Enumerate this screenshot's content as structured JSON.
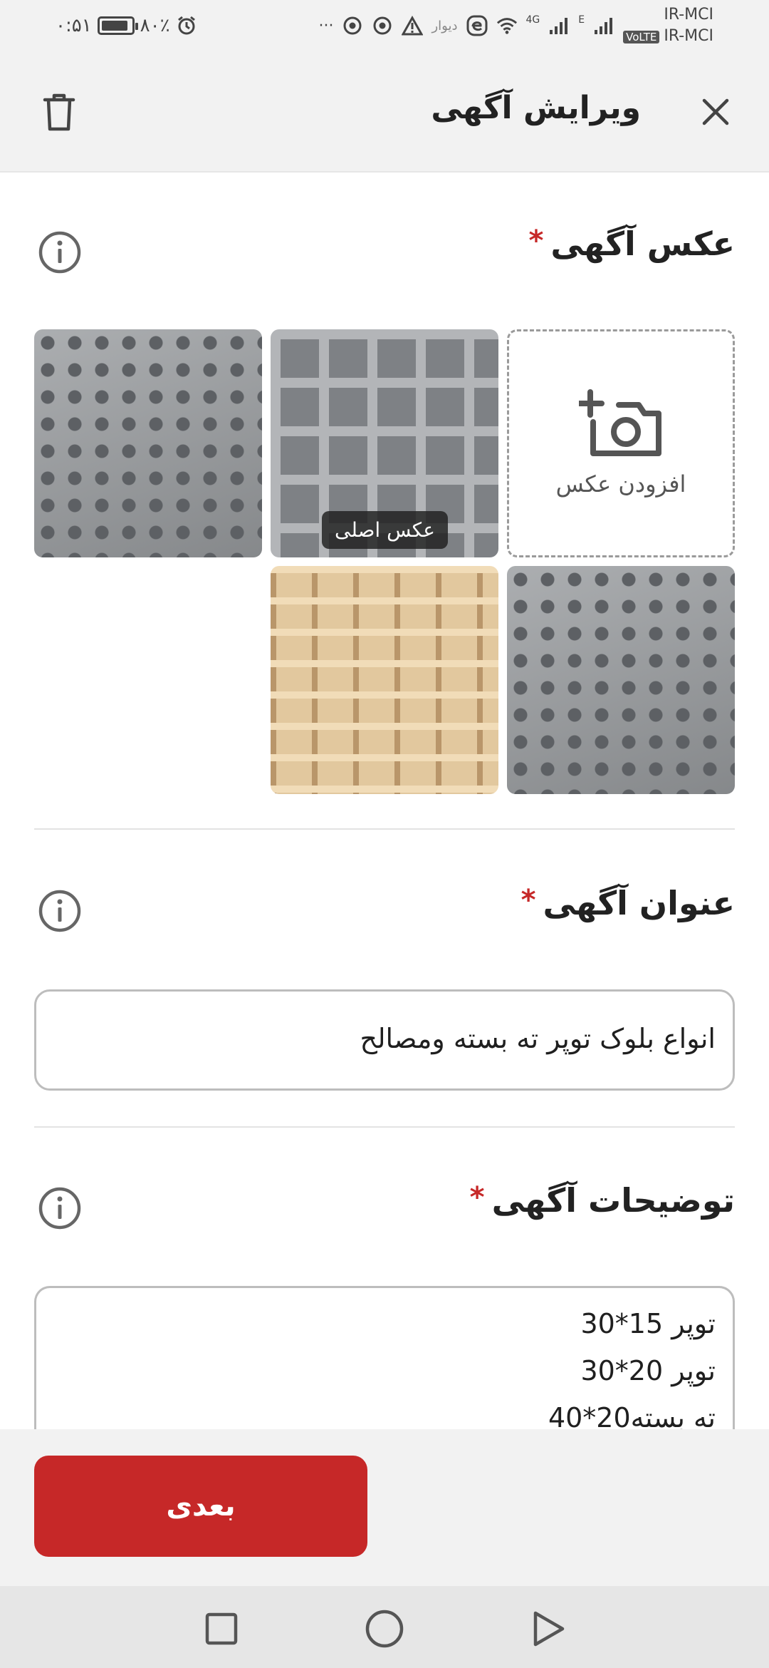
{
  "status_bar": {
    "time": "۰:۵۱",
    "battery": "۸۰٪",
    "app_label": "دیوار",
    "network": "4G",
    "network_e": "E",
    "volte": "VoLTE",
    "carrier1": "IR-MCI",
    "carrier2": "IR-MCI",
    "dots": "···"
  },
  "header": {
    "title": "ویرایش آگهی"
  },
  "photos": {
    "title": "عکس آگهی",
    "required_mark": "*",
    "add_label": "افزودن عکس",
    "main_badge": "عکس اصلی"
  },
  "ad_title": {
    "title": "عنوان آگهی",
    "required_mark": "*",
    "value": "انواع بلوک توپر ته بسته ومصالح"
  },
  "description": {
    "title": "توضیحات آگهی",
    "required_mark": "*",
    "lines": [
      "توپر 15*30",
      "توپر 20*30",
      "ته بسته20*40"
    ]
  },
  "footer": {
    "next_label": "بعدی"
  }
}
